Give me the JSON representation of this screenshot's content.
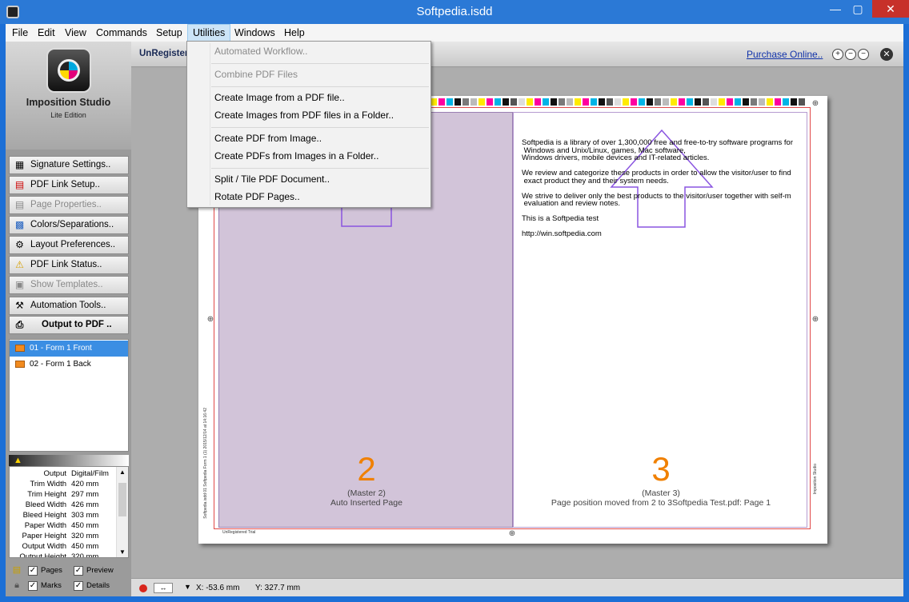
{
  "window": {
    "title": "Softpedia.isdd",
    "min": "—",
    "max": "▢",
    "close": "✕"
  },
  "menu": [
    "File",
    "Edit",
    "View",
    "Commands",
    "Setup",
    "Utilities",
    "Windows",
    "Help"
  ],
  "logo": {
    "title": "Imposition Studio",
    "subtitle": "Lite Edition"
  },
  "nav_buttons": [
    {
      "label": "Signature Settings..",
      "icon": "grid-icon",
      "glyph": "▦",
      "disabled": false
    },
    {
      "label": "PDF Link Setup..",
      "icon": "pdf-icon",
      "glyph": "📄",
      "disabled": false
    },
    {
      "label": "Page Properties..",
      "icon": "page-properties-icon",
      "glyph": "▤",
      "disabled": true
    },
    {
      "label": "Colors/Separations..",
      "icon": "colors-icon",
      "glyph": "▩",
      "disabled": false
    },
    {
      "label": "Layout Preferences..",
      "icon": "gear-icon",
      "glyph": "⚙",
      "disabled": false
    },
    {
      "label": "PDF Link Status..",
      "icon": "warning-icon",
      "glyph": "⚠",
      "disabled": false
    },
    {
      "label": "Show Templates..",
      "icon": "templates-icon",
      "glyph": "▣",
      "disabled": true
    },
    {
      "label": "Automation Tools..",
      "icon": "automation-icon",
      "glyph": "⚒",
      "disabled": false
    },
    {
      "label": "Output to PDF ..",
      "icon": "printer-icon",
      "glyph": "⎙",
      "disabled": false
    }
  ],
  "forms": [
    {
      "label": "01 - Form 1 Front",
      "selected": true
    },
    {
      "label": "02 - Form 1 Back",
      "selected": false
    }
  ],
  "info": [
    {
      "k": "Output",
      "v": "Digital/Film"
    },
    {
      "k": "Trim Width",
      "v": "420 mm"
    },
    {
      "k": "Trim Height",
      "v": "297 mm"
    },
    {
      "k": "Bleed Width",
      "v": "426 mm"
    },
    {
      "k": "Bleed Height",
      "v": "303 mm"
    },
    {
      "k": "Paper Width",
      "v": "450 mm"
    },
    {
      "k": "Paper Height",
      "v": "320 mm"
    },
    {
      "k": "Output Width",
      "v": "450 mm"
    },
    {
      "k": "Output Height",
      "v": "320 mm"
    }
  ],
  "options": {
    "pages": "Pages",
    "preview": "Preview",
    "marks": "Marks",
    "details": "Details",
    "check": "✓"
  },
  "toolbar": {
    "unregistered": "UnRegistere",
    "purchase": "Purchase Online..",
    "zoom_in": "+",
    "zoom_reset": "−",
    "zoom_out": "−",
    "close": "✕"
  },
  "utilities_menu": {
    "items": [
      {
        "label": "Automated Workflow..",
        "disabled": true
      },
      {
        "label": "Combine PDF Files",
        "disabled": true
      },
      {
        "label": "Create Image from a PDF file..",
        "disabled": false
      },
      {
        "label": "Create Images from PDF files in a Folder..",
        "disabled": false
      },
      {
        "label": "Create PDF from Image..",
        "disabled": false
      },
      {
        "label": "Create PDFs from Images in a Folder..",
        "disabled": false
      },
      {
        "label": "Split / Tile  PDF Document..",
        "disabled": false
      },
      {
        "label": "Rotate PDF Pages..",
        "disabled": false
      }
    ]
  },
  "sheet": {
    "left_page": {
      "number": "2",
      "master": "(Master 2)",
      "desc": "Auto Inserted Page"
    },
    "right_page": {
      "number": "3",
      "master": "(Master 3)",
      "desc": "Page position moved from 2 to 3Softpedia Test.pdf: Page 1"
    },
    "sample_text": "Softpedia is a library of over 1,300,000 free and free-to-try software programs for\n Windows and Unix/Linux, games, Mac software,\nWindows drivers, mobile devices and IT-related articles.\n\nWe review and categorize these products in order to allow the visitor/user to find\n exact product they and their system needs.\n\nWe strive to deliver only the best products to the visitor/user together with self-m\n evaluation and review notes.\n\nThis is a Softpedia test\n\nhttp://win.softpedia.com",
    "slug": "UnRegistered Trial",
    "side_slug": "Softpedia.isdd  01 Softpedia Form 1 (1)  2015/12/14 at 14:16:42",
    "right_slug": "Imposition Studio",
    "color_swatches": [
      "#ffeb00",
      "#ff00a0",
      "#00b4e6",
      "#111111",
      "#7a7a7a",
      "#bbbbbb",
      "#ffeb00",
      "#ff00a0",
      "#00b4e6",
      "#111111",
      "#555555",
      "#dddddd"
    ]
  },
  "status": {
    "x": "X: -53.6 mm",
    "y": "Y: 327.7 mm",
    "tool": "↔",
    "arrow": "▼"
  }
}
